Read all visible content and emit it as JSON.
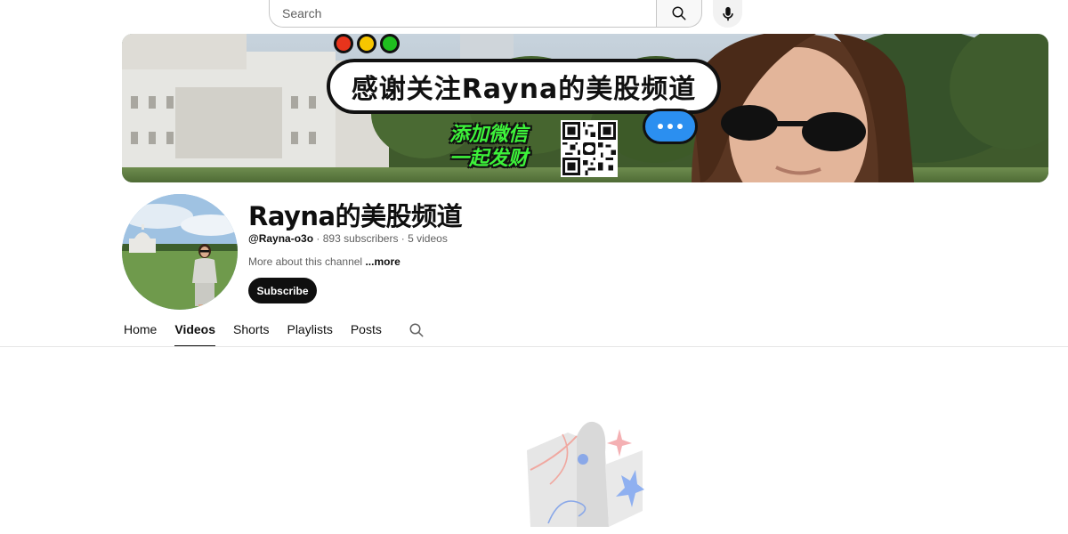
{
  "search": {
    "placeholder": "Search",
    "value": ""
  },
  "banner": {
    "headline": "感谢关注Rayna的美股频道",
    "tagline_line1": "添加微信",
    "tagline_line2": "一起发财",
    "window_dot_colors": [
      "#e8341c",
      "#f7c600",
      "#1fbf1f"
    ]
  },
  "channel": {
    "name": "Rayna的美股频道",
    "handle": "@Rayna-o3o",
    "subscribers": "893 subscribers",
    "videos": "5 videos",
    "separator": " · ",
    "about": "More about this channel",
    "more_label": "...more",
    "subscribe_label": "Subscribe"
  },
  "tabs": [
    {
      "label": "Home",
      "active": false
    },
    {
      "label": "Videos",
      "active": true
    },
    {
      "label": "Shorts",
      "active": false
    },
    {
      "label": "Playlists",
      "active": false
    },
    {
      "label": "Posts",
      "active": false
    }
  ],
  "colors": {
    "accent": "#0f0f0f",
    "secondary_text": "#606060",
    "banner_button": "#2b8ff0",
    "tagline_green": "#3df23a"
  }
}
